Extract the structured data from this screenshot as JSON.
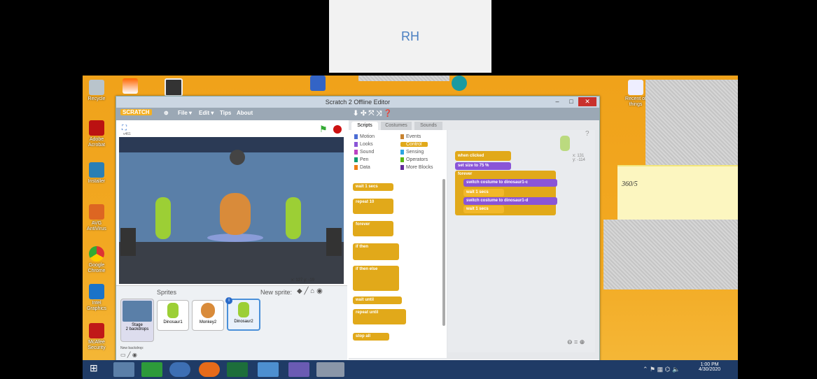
{
  "participant": {
    "initials": "RH"
  },
  "desktop": {
    "icons": [
      "Recycle",
      "Adobe Acrobat",
      "Installer",
      "AVG AntiVirus",
      "Google Chrome",
      "Intel Graphics",
      "McAfee Security"
    ],
    "right_icon": "Recent of things",
    "note_text": "360/5"
  },
  "window": {
    "title": "Scratch 2 Offline Editor",
    "menu": {
      "file": "File ▾",
      "edit": "Edit ▾",
      "tips": "Tips",
      "about": "About",
      "brand": "SCRATCH"
    },
    "version": "v461",
    "tabs": [
      "Scripts",
      "Costumes",
      "Sounds"
    ],
    "categories_left": [
      "Motion",
      "Looks",
      "Sound",
      "Pen",
      "Data"
    ],
    "categories_right": [
      "Events",
      "Control",
      "Sensing",
      "Operators",
      "More Blocks"
    ],
    "palette_blocks": [
      "wait 1 secs",
      "repeat 10",
      "forever",
      "if then",
      "if then else",
      "wait until",
      "repeat until",
      "stop all"
    ],
    "script": {
      "hat": "when clicked",
      "set_size": "set size to 75 %",
      "forever": "forever",
      "switch1": "switch costume to dinosaur1-c",
      "wait1": "wait 1 secs",
      "switch2": "switch costume to dinosaur1-d",
      "wait2": "wait 1 secs"
    },
    "sprite_coords": "x: 131\ny: -114",
    "zoom": "⊖ = ⊕",
    "stage_coords": "x: 127  y: -19",
    "sprites_label": "Sprites",
    "new_sprite": "New sprite:",
    "sprites": [
      "Dinosaur1",
      "Monkey2",
      "Dinosaur2"
    ],
    "stage_label": "Stage",
    "stage_backdrops": "2 backdrops",
    "new_backdrop": "New backdrop:"
  },
  "taskbar": {
    "time": "1:00 PM",
    "date": "4/30/2020"
  }
}
